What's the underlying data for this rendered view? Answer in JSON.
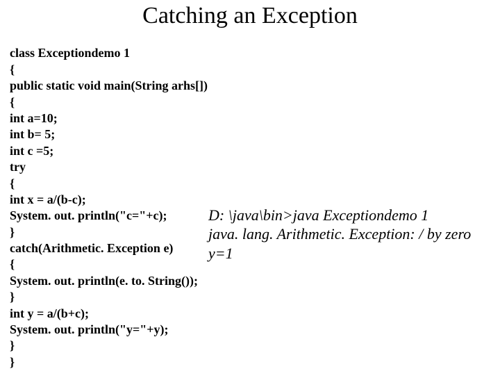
{
  "title": "Catching an Exception",
  "code": {
    "l1": "class Exceptiondemo 1",
    "l2": "{",
    "l3": "public static void main(String arhs[])",
    "l4": "{",
    "l5": "int a=10;",
    "l6": "int b= 5;",
    "l7": "int c =5;",
    "l8": "try",
    "l9": "{",
    "l10": "int x = a/(b-c);",
    "l11": "System. out. println(\"c=\"+c);",
    "l12": "}",
    "l13": "catch(Arithmetic. Exception e)",
    "l14": "{",
    "l15": "System. out. println(e. to. String());",
    "l16": "}",
    "l17": "int y = a/(b+c);",
    "l18": "System. out. println(\"y=\"+y);",
    "l19": "}",
    "l20": "}"
  },
  "output": {
    "l1": "D: \\java\\bin>java Exceptiondemo 1",
    "l2": "java. lang. Arithmetic. Exception: / by zero",
    "l3": "y=1"
  }
}
